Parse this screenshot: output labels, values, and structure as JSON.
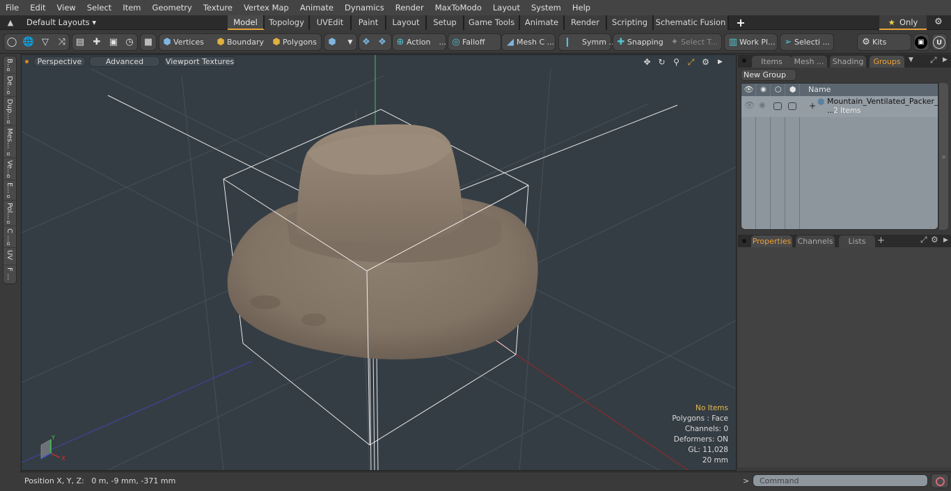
{
  "menu": [
    "File",
    "Edit",
    "View",
    "Select",
    "Item",
    "Geometry",
    "Texture",
    "Vertex Map",
    "Animate",
    "Dynamics",
    "Render",
    "MaxToModo",
    "Layout",
    "System",
    "Help"
  ],
  "layout_bar": {
    "layouts_label": "Default Layouts",
    "tabs": [
      {
        "label": "Model",
        "active": true
      },
      {
        "label": "Topology"
      },
      {
        "label": "UVEdit"
      },
      {
        "label": "Paint"
      },
      {
        "label": "Layout"
      },
      {
        "label": "Setup"
      },
      {
        "label": "Game Tools"
      },
      {
        "label": "Animate"
      },
      {
        "label": "Render"
      },
      {
        "label": "Scripting"
      },
      {
        "label": "Schematic Fusion"
      }
    ],
    "add_tab": "+",
    "only_label": "Only"
  },
  "toolbar": {
    "vertices": "Vertices",
    "boundary": "Boundary",
    "polygons": "Polygons",
    "action": "Action",
    "action_more": "...",
    "falloff": "Falloff",
    "mesh_c": "Mesh C ...",
    "symm": "Symm ...",
    "snapping": "Snapping",
    "select_t": "Select T...",
    "work_pl": "Work Pl...",
    "selecti": "Selecti ...",
    "kits": "Kits"
  },
  "left_tabs": [
    "B...",
    "De...",
    "Dup...",
    "Mes...",
    "Ve...",
    "E...",
    "Pol...",
    "C ...",
    "UV",
    "F ..."
  ],
  "viewport": {
    "buttons": [
      "Perspective",
      "Advanced",
      "Viewport Textures"
    ],
    "stats": {
      "selection": "No Items",
      "polygons": "Polygons : Face",
      "channels": "Channels: 0",
      "deformers": "Deformers: ON",
      "gl": "GL: 11,028",
      "scale": "20 mm"
    }
  },
  "status": {
    "position_label": "Position X, Y, Z:",
    "position_value": "0 m, -9 mm, -371 mm"
  },
  "right_panel": {
    "tabs": [
      {
        "label": "Items"
      },
      {
        "label": "Mesh ..."
      },
      {
        "label": "Shading"
      },
      {
        "label": "Groups",
        "active": true
      }
    ],
    "new_group": "New Group",
    "column_name": "Name",
    "group": {
      "name": "Mountain_Ventilated_Packer_ ...",
      "count": "2 Items"
    },
    "prop_tabs": [
      {
        "label": "Properties",
        "active": true
      },
      {
        "label": "Channels"
      },
      {
        "label": "Lists"
      }
    ],
    "add_tab": "+"
  },
  "command": {
    "prompt": ">",
    "placeholder": "Command"
  },
  "colors": {
    "accent": "#e8a33a",
    "active_tab_text": "#f0a030",
    "viewport_bg": "#353d44",
    "hat": "#8a7b6c"
  }
}
